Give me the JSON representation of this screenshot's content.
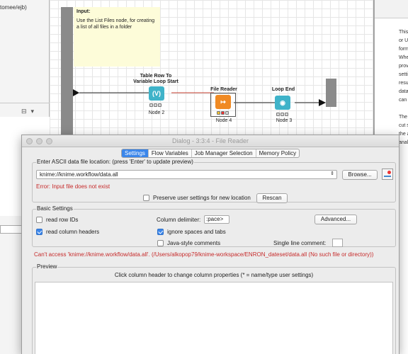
{
  "workbench": {
    "left_path": "tomee/ejb)",
    "annotation": {
      "title": "Input:",
      "body": "Use the List Files node, for creating a list of all files in a folder"
    },
    "nodes": [
      {
        "title_line1": "Table Row To",
        "title_line2": "Variable Loop Start",
        "label": "Node 2",
        "glyph": "(V)"
      },
      {
        "title_line1": "File Reader",
        "title_line2": "",
        "label": "Node 4",
        "glyph": "↦"
      },
      {
        "title_line1": "Loop End",
        "title_line2": "",
        "label": "Node 3",
        "glyph": "◉"
      }
    ],
    "right_panel_lines": [
      "This",
      "or U",
      "form",
      "Whe",
      "prov",
      "setti",
      "resu",
      "data",
      "can a",
      "",
      "The",
      "cut s",
      "the a",
      "anal"
    ],
    "colors": {
      "loop_start_node": "#3fb3c9",
      "file_reader_node": "#f08a24",
      "loop_end_node": "#3fb3c9",
      "metanode": "#8a8a8a",
      "annotation_bg": "#fdfcd9"
    }
  },
  "dialog": {
    "title": "Dialog - 3:3:4 - File Reader",
    "tabs": [
      {
        "label": "Settings",
        "active": true
      },
      {
        "label": "Flow Variables",
        "active": false
      },
      {
        "label": "Job Manager Selection",
        "active": false
      },
      {
        "label": "Memory Policy",
        "active": false
      }
    ],
    "file_group": {
      "legend": "Enter ASCII data file location: (press 'Enter' to update preview)",
      "location_value": "knime://knime.workflow/data.all",
      "browse_label": "Browse...",
      "error": "Error: Input file does not exist",
      "preserve_label": "Preserve user settings for new location",
      "preserve_checked": false,
      "rescan_label": "Rescan"
    },
    "basic_group": {
      "legend": "Basic Settings",
      "read_row_ids_label": "read row IDs",
      "read_row_ids_checked": false,
      "read_column_headers_label": "read column headers",
      "read_column_headers_checked": true,
      "column_delimiter_label": "Column delimiter:",
      "column_delimiter_value": ":pace>",
      "advanced_label": "Advanced...",
      "ignore_spaces_label": "ignore spaces and tabs",
      "ignore_spaces_checked": true,
      "java_comments_label": "Java-style comments",
      "java_comments_checked": false,
      "single_line_comment_label": "Single line comment:",
      "single_line_comment_value": ""
    },
    "access_error": "Can't access 'knime://knime.workflow/data.all'. (/Users/alkopop79/knime-workspace/ENRON_dateset/data.all (No such file or directory))",
    "preview_group": {
      "legend": "Preview",
      "hint": "Click column header to change column properties (* = name/type user settings)"
    },
    "colors": {
      "active_tab": "#3b86ea",
      "error": "#c62a2a"
    }
  }
}
